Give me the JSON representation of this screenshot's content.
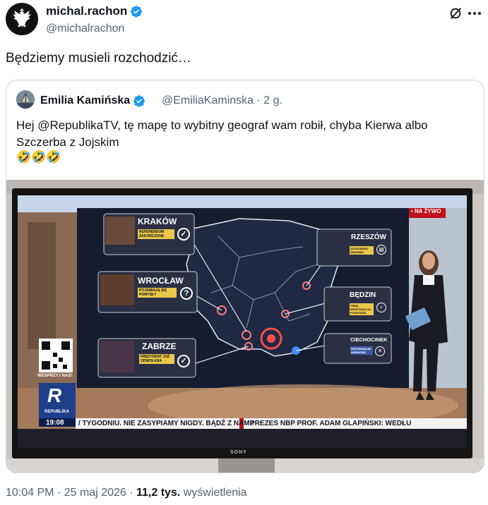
{
  "tweet": {
    "author_name": "michal.rachon",
    "author_handle": "@michalrachon",
    "text": "Będziemy musieli rozchodzić…",
    "time": "10:04 PM",
    "sep": "·",
    "date": "25 maj 2026",
    "sep2": "·",
    "views_count": "11,2 tys.",
    "views_label": "wyświetlenia"
  },
  "quote": {
    "author_name": "Emilia Kamińska",
    "author_handle": "@EmiliaKaminska",
    "age": "· 2 g.",
    "text": "Hej @RepublikaTV, tę mapę to wybitny geograf wam robił, chyba Kierwa albo Szczerba z Jojskim",
    "emoji": "🤣🤣🤣"
  },
  "photo": {
    "live_badge": "• NA ŻYWO",
    "cities": [
      {
        "name": "KRAKÓW",
        "tag": "REFERENDUM ZAKOŃCZONE",
        "mark": "✓"
      },
      {
        "name": "WROCŁAW",
        "tag": "POJAWIAJĄ SIĘ POMYSŁY",
        "mark": "?"
      },
      {
        "name": "ZABRZE",
        "tag": "PREZYDENT JUŻ ODWOŁANA",
        "mark": "✓"
      },
      {
        "name": "RZESZÓW",
        "tag": "SZYKOWANY WNIOSEK",
        "mark": "▤"
      },
      {
        "name": "BĘDZIN",
        "tag": "TRWA WERYFIKACJA PODPISÓW",
        "mark": "⌕"
      },
      {
        "name": "CIECHOCINEK",
        "tag": "REFERENDUM NIEWAŻNE",
        "mark": "✕"
      }
    ],
    "qr_label": "WESPRZYJ NAS!",
    "logo_letter": "R",
    "logo_text": "REPUBLIKA",
    "clock": "19:08",
    "ticker1": "/ TYGODNIU. NIE ZASYPIAMY NIGDY. BĄDŹ Z NAMI!",
    "ticker2": "PREZES NBP PROF. ADAM GLAPIŃSKI: WEDŁU",
    "tv_brand": "SONY"
  },
  "colors": {
    "verified": "#1d9bf0",
    "text": "#0f1419",
    "muted": "#536471"
  },
  "icons": [
    "eagle-avatar-icon",
    "verified-badge-icon",
    "grok-icon",
    "more-icon"
  ]
}
